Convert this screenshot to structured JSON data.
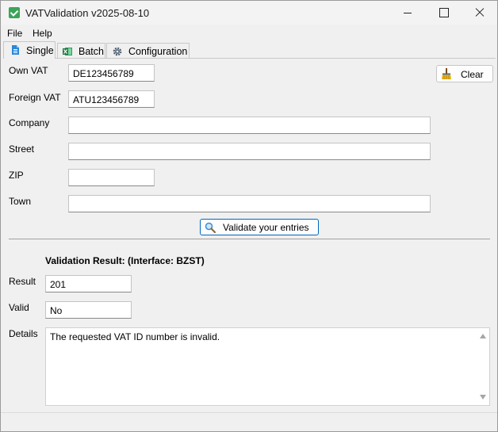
{
  "window": {
    "title": "VATValidation v2025-08-10"
  },
  "menu": {
    "file": "File",
    "help": "Help"
  },
  "tabs": [
    {
      "label": "Single",
      "icon": "document-icon",
      "active": true
    },
    {
      "label": "Batch",
      "icon": "excel-icon",
      "active": false
    },
    {
      "label": "Configuration",
      "icon": "gear-icon",
      "active": false
    }
  ],
  "form": {
    "own_vat_label": "Own VAT",
    "own_vat_value": "DE123456789",
    "foreign_vat_label": "Foreign VAT",
    "foreign_vat_value": "ATU123456789",
    "company_label": "Company",
    "company_value": "",
    "street_label": "Street",
    "street_value": "",
    "zip_label": "ZIP",
    "zip_value": "",
    "town_label": "Town",
    "town_value": ""
  },
  "buttons": {
    "clear": "Clear",
    "validate": "Validate your entries"
  },
  "result": {
    "heading": "Validation Result: (Interface: BZST)",
    "result_label": "Result",
    "result_value": "201",
    "valid_label": "Valid",
    "valid_value": "No",
    "details_label": "Details",
    "details_value": "The requested VAT ID number is invalid."
  },
  "colors": {
    "accent": "#0067c0",
    "app_icon": "#3aa457",
    "excel": "#1d7a43"
  }
}
